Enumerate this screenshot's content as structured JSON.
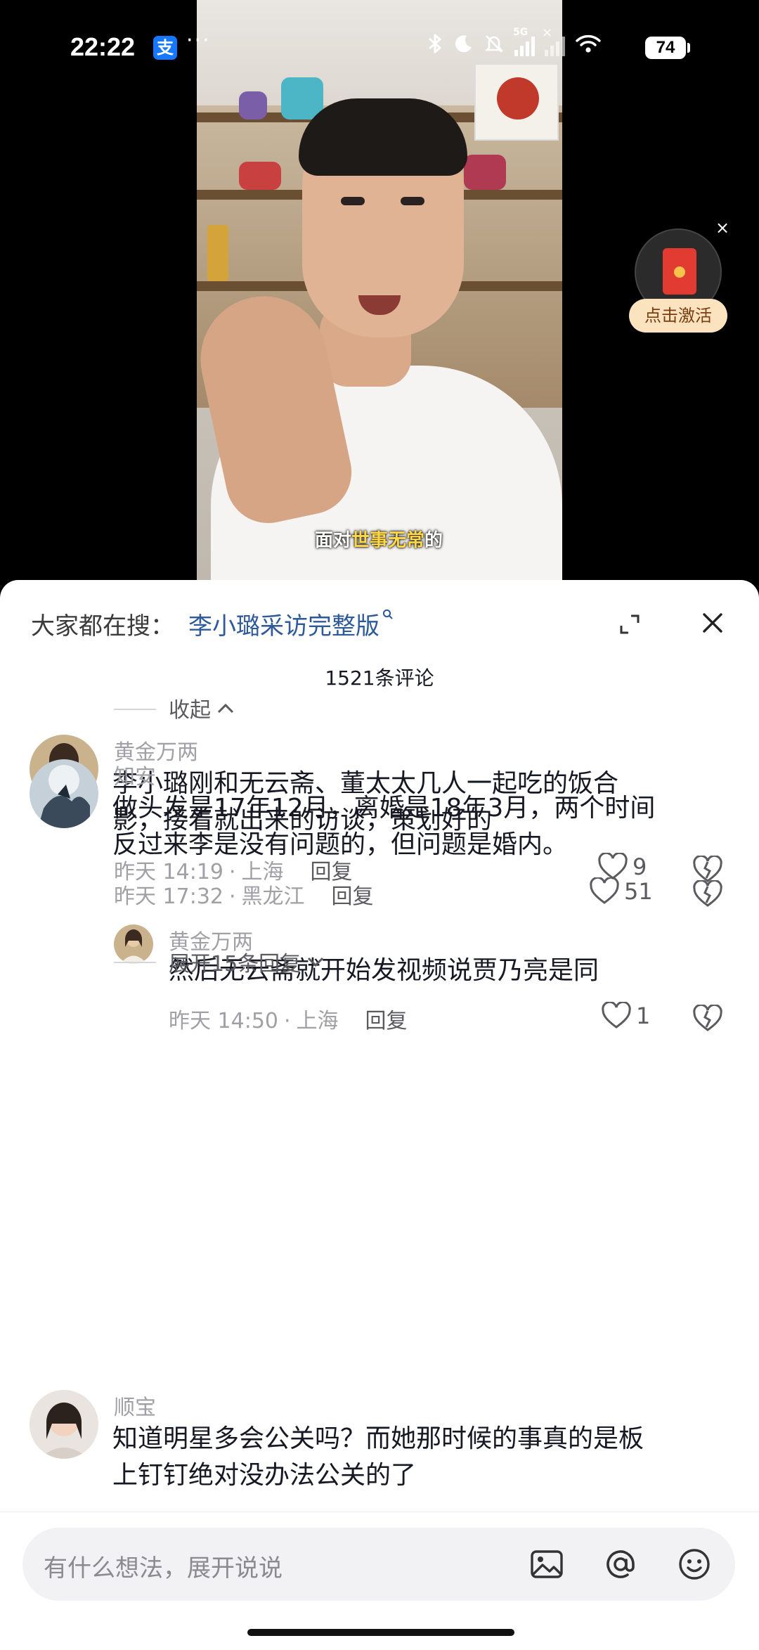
{
  "status_bar": {
    "time": "22:22",
    "app_badge": "支",
    "more": "···",
    "network": "5G",
    "battery": "74"
  },
  "video": {
    "subtitle_prefix": "面对",
    "subtitle_highlight": "世事无常",
    "subtitle_suffix": "的"
  },
  "activate_widget": {
    "label": "点击激活",
    "close": "×"
  },
  "comments_panel": {
    "search_prefix": "大家都在搜：",
    "search_link": "李小璐采访完整版",
    "count_label": "1521条评论",
    "collapse_label": "收起",
    "expand_label": "展开15条回复",
    "comments": [
      {
        "author": "黄金万两",
        "text_line1": "李小璐刚和无云斋、董太太几人一起吃的饭合",
        "text_line2": "影，接着就出来的访谈，策划好的",
        "time": "昨天 14:19",
        "location": "上海",
        "reply": "回复",
        "likes": "9"
      },
      {
        "author": "黄金万两",
        "text_line1": "然后无云斋就开始发视频说贾乃亮是同",
        "time": "昨天 14:50",
        "location": "上海",
        "reply": "回复",
        "likes": "1"
      },
      {
        "author": "知安",
        "text_line1": "做头发是17年12月，离婚是18年3月，两个时间",
        "text_line2": "反过来李是没有问题的，但问题是婚内。",
        "time": "昨天 17:32",
        "location": "黑龙江",
        "reply": "回复",
        "likes": "51"
      },
      {
        "author": "顺宝",
        "text_line1": "知道明星多会公关吗？而她那时候的事真的是板",
        "text_line2": "上钉钉绝对没办法公关的了"
      }
    ]
  },
  "input_bar": {
    "placeholder": "有什么想法，展开说说"
  }
}
